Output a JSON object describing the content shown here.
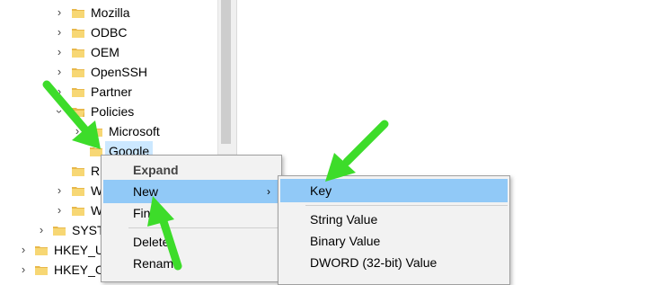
{
  "tree": {
    "rows": [
      {
        "label": "Mozilla",
        "indent": 3,
        "expander": "collapsed"
      },
      {
        "label": "ODBC",
        "indent": 3,
        "expander": "collapsed"
      },
      {
        "label": "OEM",
        "indent": 3,
        "expander": "collapsed"
      },
      {
        "label": "OpenSSH",
        "indent": 3,
        "expander": "collapsed"
      },
      {
        "label": "Partner",
        "indent": 3,
        "expander": "collapsed"
      },
      {
        "label": "Policies",
        "indent": 3,
        "expander": "expanded"
      },
      {
        "label": "Microsoft",
        "indent": 4,
        "expander": "collapsed"
      },
      {
        "label": "Google",
        "indent": 4,
        "expander": "none",
        "selected": true
      },
      {
        "label": "R",
        "indent": 3,
        "expander": "none"
      },
      {
        "label": "W",
        "indent": 3,
        "expander": "collapsed"
      },
      {
        "label": "W",
        "indent": 3,
        "expander": "collapsed"
      },
      {
        "label": "SYST",
        "indent": 2,
        "expander": "collapsed"
      },
      {
        "label": "HKEY_U",
        "indent": 1,
        "expander": "collapsed"
      },
      {
        "label": "HKEY_C",
        "indent": 1,
        "expander": "collapsed"
      }
    ]
  },
  "context_menu": {
    "items": [
      "Expand",
      "New",
      "Find...",
      "Delete",
      "Rename"
    ],
    "highlighted": "New"
  },
  "new_submenu": {
    "items": [
      "Key",
      "String Value",
      "Binary Value",
      "DWORD (32-bit) Value"
    ],
    "highlighted": "Key"
  },
  "colors": {
    "menu_bg": "#f2f2f2",
    "highlight": "#91c9f7",
    "selection": "#cce8ff",
    "folder": "#e8b84a",
    "annotation_arrow": "#3ddc2a"
  }
}
